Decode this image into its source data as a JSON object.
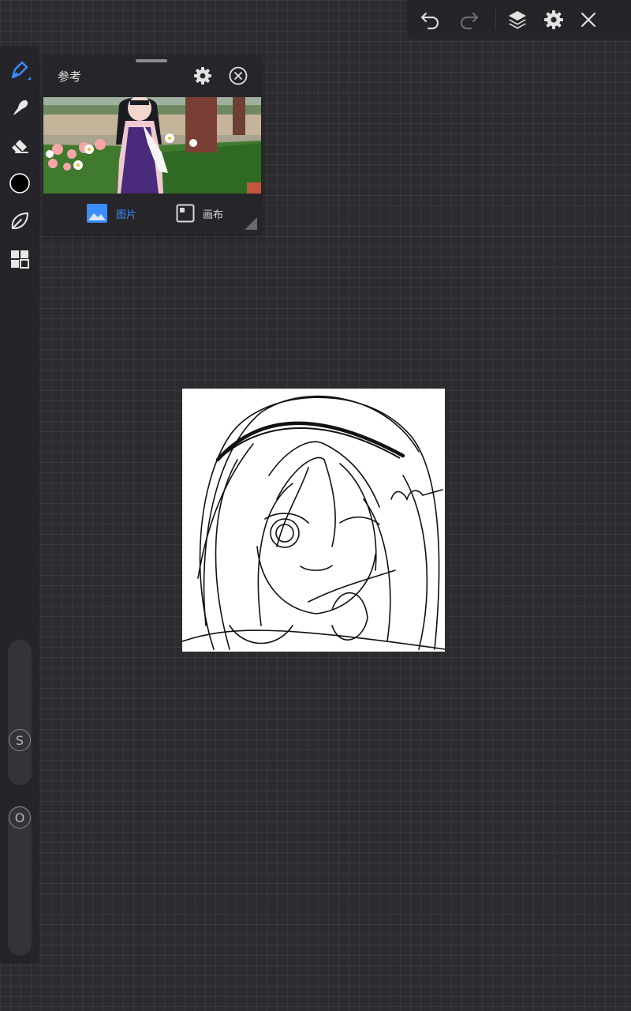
{
  "toolbar": {
    "icons": [
      "undo-icon",
      "redo-icon",
      "layers-icon",
      "settings-icon",
      "close-icon"
    ]
  },
  "tools": {
    "icons": [
      "brush-icon",
      "smudge-icon",
      "eraser-icon",
      "color-swatch",
      "leaf-icon",
      "gallery-icon"
    ],
    "active_tool": "brush",
    "current_color": "#000000",
    "accent_color": "#3b8cff"
  },
  "sliders": {
    "size_label": "S",
    "opacity_label": "O"
  },
  "reference": {
    "title": "参考",
    "tab_image": "图片",
    "tab_canvas": "画布",
    "active_tab": "image"
  }
}
